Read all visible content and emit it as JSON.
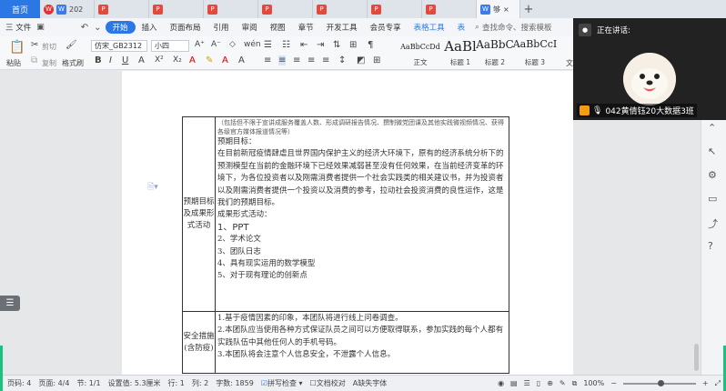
{
  "tabs": {
    "home": "首页",
    "items": [
      {
        "label": "202",
        "type": "w"
      },
      {
        "label": "",
        "type": "p"
      },
      {
        "label": "",
        "type": "p"
      },
      {
        "label": "",
        "type": "p"
      },
      {
        "label": "",
        "type": "p"
      },
      {
        "label": "",
        "type": "p"
      },
      {
        "label": "",
        "type": "p"
      },
      {
        "label": "",
        "type": "p"
      },
      {
        "label": "",
        "type": "p"
      },
      {
        "label": "够",
        "type": "w"
      }
    ],
    "new_tab": "+"
  },
  "menu": {
    "file": "三 文件",
    "items": [
      "开始",
      "插入",
      "页面布局",
      "引用",
      "审阅",
      "视图",
      "章节",
      "开发工具",
      "会员专享",
      "表格工具",
      "表"
    ],
    "search": "查找命令、搜索模板"
  },
  "toolbar": {
    "paste": "粘贴",
    "cut": "剪切",
    "copy": "复制",
    "format_painter": "格式刷",
    "font_name": "仿宋_GB2312",
    "font_size": "小四",
    "styles": [
      {
        "sample": "AaBbCcDd",
        "label": "正文"
      },
      {
        "sample": "AaBl",
        "label": "标题 1"
      },
      {
        "sample": "AaBbC",
        "label": "标题 2"
      },
      {
        "sample": "AaBbCcI",
        "label": "标题 3"
      }
    ],
    "more": "文"
  },
  "document": {
    "row1_label": "预期目标及成果形式活动",
    "row1_note": "（包括但不限于宣讲成服务覆盖人数、形成调研报告情况、撰制微党团课及其他实践微视频情况、获得各级官方媒体报道情况等）",
    "row1_head": "预期目标：",
    "row1_para": "在目前新冠疫情肆虐且世界国内保护主义的经济大环境下，原有的经济系统分析下的预测模型在当前的金融环境下已经效果减弱甚至没有任何效果，在当前经济变革的环境下，为各位投资者以及刚需消费者提供一个社会实践类的相关建议书，并为投资者以及刚需消费者提供一个投资以及消费的参考，拉动社会投资消费的良性运作，这是我们的预期目标。",
    "row1_out": "成果形式活动：",
    "row1_list": [
      "1、PPT",
      "2、学术论文",
      "3、团队日志",
      "4、具有现实运用的数学模型",
      "5、对于现有理论的创新点"
    ],
    "row2_label": "安全措施(含防疫)",
    "row2_list": [
      "1.基于疫情因素的印象，本团队将进行线上问卷调查。",
      "2.本团队应当使用各种方式保证队员之间可以方便取得联系，参加实践的每个人都有实践队伍中其他任何人的手机号码。",
      "3.本团队将会注意个人信息安全，不泄露个人信息。"
    ]
  },
  "video": {
    "speaking": "正在讲话:",
    "name": "042黄倩钰20大数据3班"
  },
  "status": {
    "page_num": "页码: 4",
    "pages": "页面: 4/4",
    "section": "节: 1/1",
    "setting": "设置值: 5.3厘米",
    "row": "行: 1",
    "col": "列: 2",
    "words": "字数: 1859",
    "spell": "拼写检查",
    "proof": "文档校对",
    "missing_font": "缺失字体",
    "zoom": "100%"
  }
}
